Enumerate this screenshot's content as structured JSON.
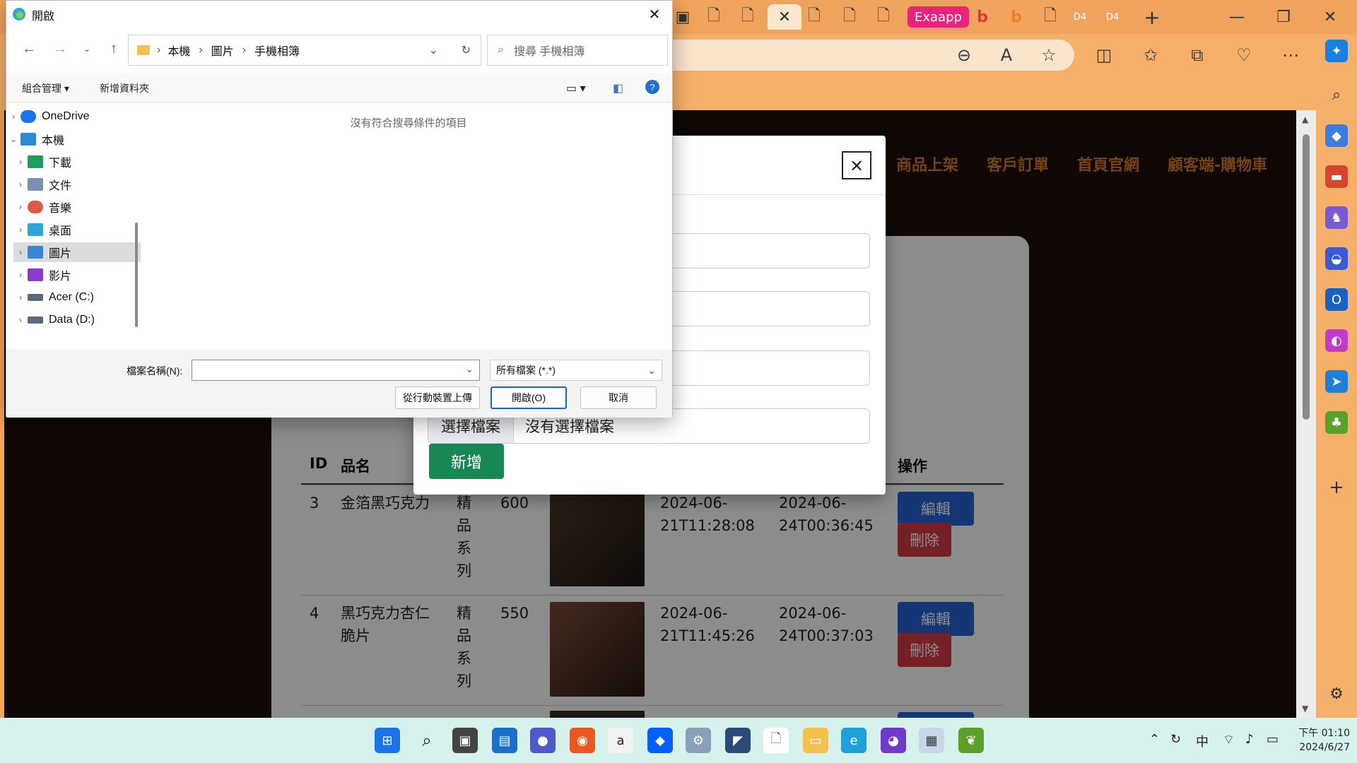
{
  "browser": {
    "tab_exaapp": "Exaapp",
    "tab_d4": "D4",
    "win_minimize": "—",
    "win_maximize": "❐",
    "win_close": "✕"
  },
  "site_nav": [
    "商品上架",
    "客戶訂單",
    "首頁官網",
    "顧客端-購物車"
  ],
  "modal": {
    "close_icon": "×",
    "file_button": "選擇檔案",
    "file_status": "沒有選擇檔案",
    "add_button": "新增"
  },
  "table": {
    "headers": {
      "id": "ID",
      "name": "品名",
      "actions": "操作"
    },
    "rows": [
      {
        "id": "3",
        "name": "金箔黑巧克力",
        "category": "精品系列",
        "price": "600",
        "created": "2024-06-21T11:28:08",
        "updated": "2024-06-24T00:36:45",
        "thumb_color": "#3a2e22"
      },
      {
        "id": "4",
        "name": "黑巧克力杏仁脆片",
        "category": "精品系列",
        "price": "550",
        "created": "2024-06-21T11:45:26",
        "updated": "2024-06-24T00:37:03",
        "thumb_color": "#5a3328"
      }
    ],
    "edit_label": "編輯",
    "delete_label": "刪除"
  },
  "file_dialog": {
    "title": "開啟",
    "path": [
      "本機",
      "圖片",
      "手機相簿"
    ],
    "search_placeholder": "搜尋 手機相簿",
    "organize": "組合管理 ▾",
    "new_folder": "新增資料夾",
    "empty_message": "沒有符合搜尋條件的項目",
    "tree": [
      {
        "label": "OneDrive",
        "icon_color": "#1a73e8"
      },
      {
        "label": "本機",
        "icon_color": "#2b8bd8"
      },
      {
        "label": "下載",
        "icon_color": "#1aa05a"
      },
      {
        "label": "文件",
        "icon_color": "#7a8fb5"
      },
      {
        "label": "音樂",
        "icon_color": "#e0584a"
      },
      {
        "label": "桌面",
        "icon_color": "#2aa6d8"
      },
      {
        "label": "圖片",
        "icon_color": "#3a86d6"
      },
      {
        "label": "影片",
        "icon_color": "#8b3ad0"
      },
      {
        "label": "Acer (C:)",
        "icon_color": "#5a6a7a"
      },
      {
        "label": "Data (D:)",
        "icon_color": "#5a6a7a"
      }
    ],
    "filename_label": "檔案名稱(N):",
    "filename_value": "",
    "filter_value": "所有檔案 (*.*)",
    "upload_button": "從行動裝置上傳",
    "open_button": "開啟(O)",
    "cancel_button": "取消"
  },
  "taskbar": {
    "clock_time": "下午 01:10",
    "clock_date": "2024/6/27",
    "ime": "中"
  }
}
